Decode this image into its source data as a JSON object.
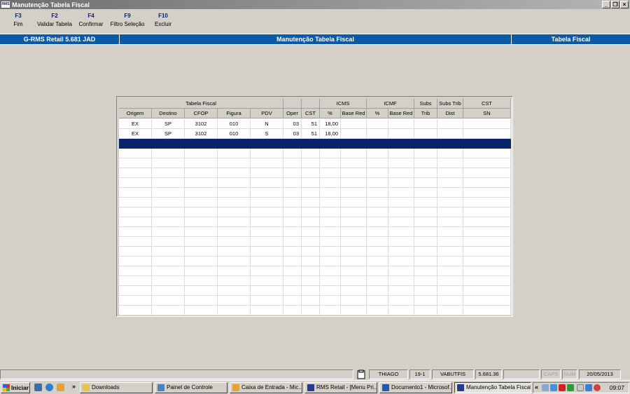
{
  "window": {
    "title": "Manutenção Tabela Fiscal",
    "app_icon_text": "RMS"
  },
  "fkeys": [
    {
      "key": "F3",
      "label": "Fim"
    },
    {
      "key": "F2",
      "label": "Validar Tabela"
    },
    {
      "key": "F4",
      "label": "Confirmar"
    },
    {
      "key": "F9",
      "label": "Filtro Seleção"
    },
    {
      "key": "F10",
      "label": "Excluir"
    }
  ],
  "topbar": {
    "left": "G-RMS Retail 5.681 JAD",
    "center": "Manutenção Tabela Fiscal",
    "right": "Tabela Fiscal",
    "color": "#0b5aa8"
  },
  "grid": {
    "group_headers": [
      "Tabela Fiscal",
      "",
      "",
      "ICMS",
      "ICMF",
      "Subs",
      "Subs Trib",
      "CST"
    ],
    "columns": [
      "Origem",
      "Destino",
      "CFOP",
      "Figura",
      "PDV",
      "Oper",
      "CST",
      "%",
      "Base Red",
      "%",
      "Base Red",
      "Trib",
      "Dist",
      "SN"
    ],
    "rows": [
      [
        "EX",
        "SP",
        "3102",
        "010",
        "N",
        "03",
        "51",
        "18,00",
        "",
        "",
        "",
        "",
        "",
        ""
      ],
      [
        "EX",
        "SP",
        "3102",
        "010",
        "S",
        "03",
        "51",
        "18,00",
        "",
        "",
        "",
        "",
        "",
        ""
      ]
    ],
    "selection_color": "#0a246a"
  },
  "statusbar": {
    "user": "THIAGO",
    "code": "19-1",
    "program": "VABUTFIS",
    "version": "5.681.36",
    "caps": "CAPS",
    "num": "NUM",
    "date": "20/05/2013"
  },
  "taskbar": {
    "start": "Iniciar",
    "more": "»",
    "items": [
      {
        "label": "Downloads",
        "icon": "folder-icon",
        "color": "#e8c547"
      },
      {
        "label": "Painel de Controle",
        "icon": "control-panel-icon",
        "color": "#4a7fc0"
      },
      {
        "label": "Caixa de Entrada - Mic...",
        "icon": "outlook-icon",
        "color": "#e8a030"
      },
      {
        "label": "RMS Retail - [Menu Pri...",
        "icon": "rms-icon",
        "color": "#2a3a8a"
      },
      {
        "label": "Documento1 - Microsof...",
        "icon": "word-icon",
        "color": "#2b57a8"
      },
      {
        "label": "Manutenção Tabela Fiscal",
        "icon": "rms-icon",
        "color": "#2a3a8a"
      }
    ],
    "tray_chevron": "«",
    "clock": "09:07"
  }
}
